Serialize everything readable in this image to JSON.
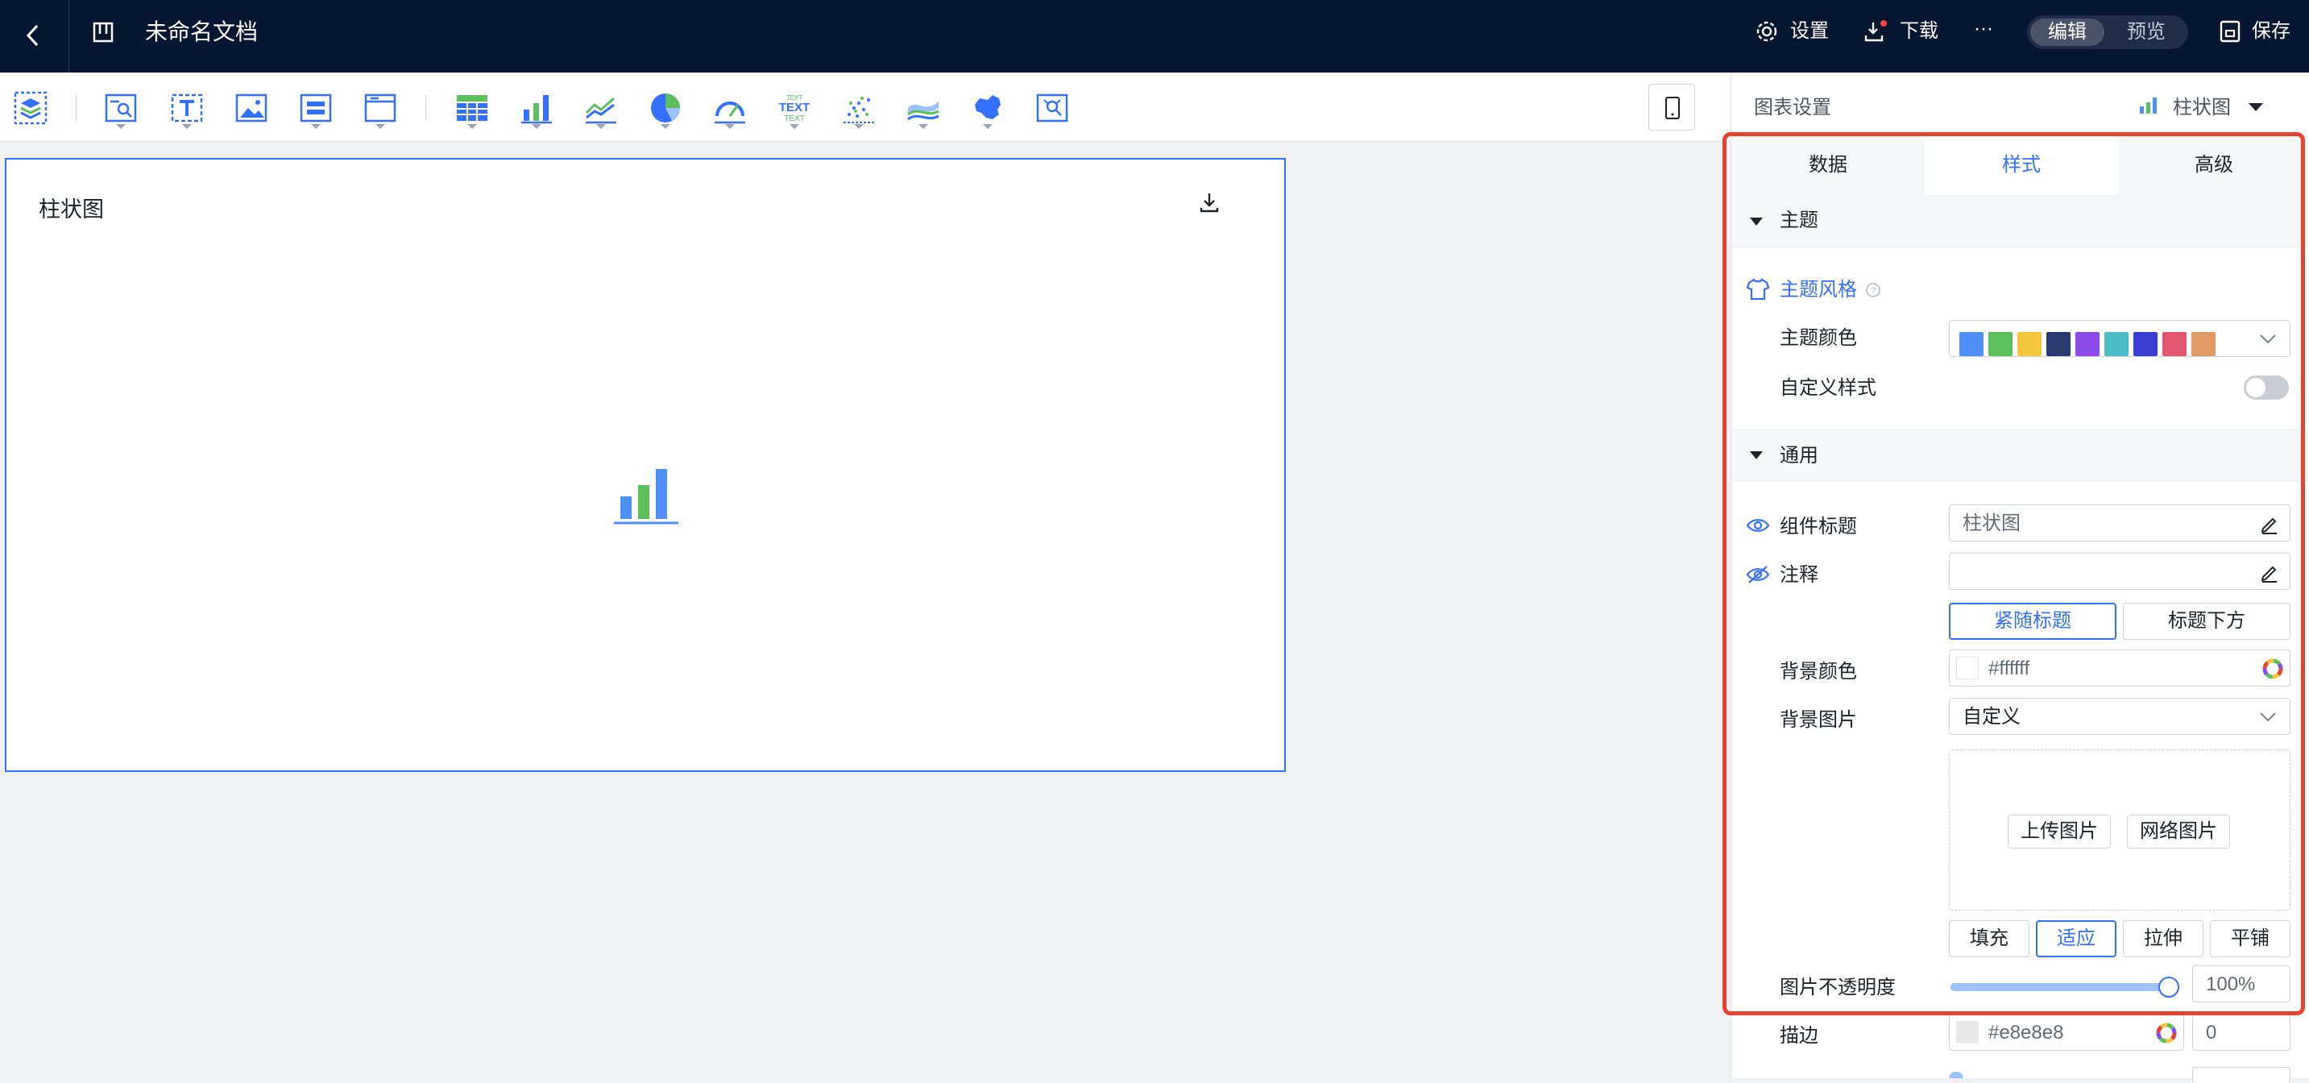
{
  "header": {
    "doc_title": "未命名文档",
    "settings_label": "设置",
    "download_label": "下载",
    "more_label": "···",
    "mode_edit": "编辑",
    "mode_preview": "预览",
    "save_label": "保存"
  },
  "toolbar": {
    "tools": [
      "layer-icon",
      "query-icon",
      "text-icon",
      "image-icon",
      "component-icon",
      "tab-icon",
      "table-icon",
      "bar-chart-icon",
      "line-chart-icon",
      "pie-chart-icon",
      "gauge-icon",
      "text-cloud-icon",
      "scatter-icon",
      "area-chart-icon",
      "map-icon",
      "custom-icon"
    ]
  },
  "canvas": {
    "card_title": "柱状图",
    "bar_colors": [
      "#4e8ff8",
      "#5bbf5b",
      "#4e8ff8"
    ]
  },
  "panel": {
    "title": "图表设置",
    "chart_type": "柱状图",
    "tabs": [
      "数据",
      "样式",
      "高级"
    ],
    "active_tab": "样式",
    "section_theme": "主题",
    "theme_style": "主题风格",
    "theme_color_label": "主题颜色",
    "theme_colors": [
      "#4e8ff8",
      "#5bbf5b",
      "#f4c73d",
      "#283a6e",
      "#8b4be8",
      "#4cbcc4",
      "#3a3ed0",
      "#e35670",
      "#e09a66"
    ],
    "custom_style_label": "自定义样式",
    "custom_style_on": false,
    "section_general": "通用",
    "component_title_label": "组件标题",
    "component_title_value": "柱状图",
    "note_label": "注释",
    "note_value": "",
    "note_position_options": [
      "紧随标题",
      "标题下方"
    ],
    "note_position_selected": "紧随标题",
    "bg_color_label": "背景颜色",
    "bg_color_value": "#ffffff",
    "bg_image_label": "背景图片",
    "bg_image_value": "自定义",
    "upload_image": "上传图片",
    "network_image": "网络图片",
    "fit_options": [
      "填充",
      "适应",
      "拉伸",
      "平铺"
    ],
    "fit_selected": "适应",
    "opacity_label": "图片不透明度",
    "opacity_value": "100%",
    "opacity_fraction": 1.0,
    "border_label": "描边",
    "border_color": "#e8e8e8",
    "border_width": "0"
  },
  "colors": {
    "accent": "#3370ff",
    "header_bg": "#071631",
    "highlight_frame": "#e5432f"
  }
}
